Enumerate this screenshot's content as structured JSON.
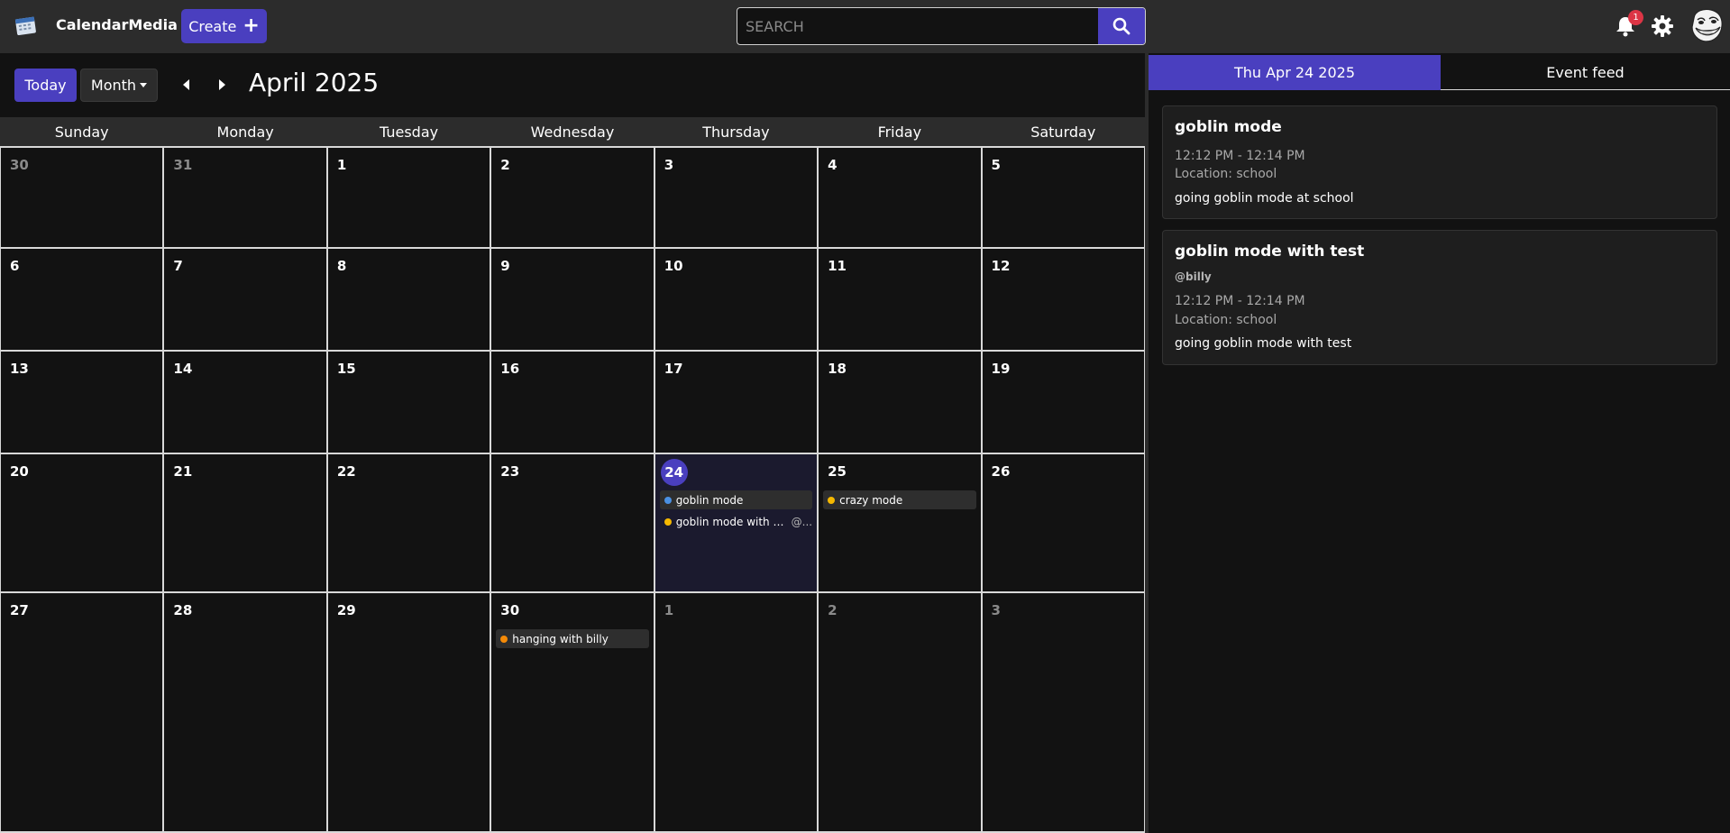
{
  "app": {
    "name": "CalendarMedia"
  },
  "header": {
    "create_label": "Create",
    "search_placeholder": "SEARCH",
    "notification_count": "1"
  },
  "toolbar": {
    "today_label": "Today",
    "view_label": "Month",
    "title": "April 2025"
  },
  "weekdays": [
    "Sunday",
    "Monday",
    "Tuesday",
    "Wednesday",
    "Thursday",
    "Friday",
    "Saturday"
  ],
  "weeks": [
    [
      {
        "d": "30",
        "m": true
      },
      {
        "d": "31",
        "m": true
      },
      {
        "d": "1"
      },
      {
        "d": "2"
      },
      {
        "d": "3"
      },
      {
        "d": "4"
      },
      {
        "d": "5"
      }
    ],
    [
      {
        "d": "6"
      },
      {
        "d": "7"
      },
      {
        "d": "8"
      },
      {
        "d": "9"
      },
      {
        "d": "10"
      },
      {
        "d": "11"
      },
      {
        "d": "12"
      }
    ],
    [
      {
        "d": "13"
      },
      {
        "d": "14"
      },
      {
        "d": "15"
      },
      {
        "d": "16"
      },
      {
        "d": "17"
      },
      {
        "d": "18"
      },
      {
        "d": "19"
      }
    ],
    [
      {
        "d": "20"
      },
      {
        "d": "21"
      },
      {
        "d": "22"
      },
      {
        "d": "23"
      },
      {
        "d": "24",
        "today": true,
        "events": [
          {
            "title": "goblin mode",
            "color": "#4a90e2",
            "highlighted": true
          },
          {
            "title": "goblin mode with test",
            "mention": "@...",
            "color": "#f5b800",
            "highlighted": false
          }
        ]
      },
      {
        "d": "25",
        "events": [
          {
            "title": "crazy mode",
            "color": "#f5b800",
            "highlighted": true
          }
        ]
      },
      {
        "d": "26"
      }
    ],
    [
      {
        "d": "27"
      },
      {
        "d": "28"
      },
      {
        "d": "29"
      },
      {
        "d": "30",
        "events": [
          {
            "title": "hanging with billy",
            "color": "#f58a07",
            "highlighted": true
          }
        ]
      },
      {
        "d": "1",
        "m": true
      },
      {
        "d": "2",
        "m": true
      },
      {
        "d": "3",
        "m": true
      }
    ]
  ],
  "panel": {
    "date_tab": "Thu Apr 24 2025",
    "feed_tab": "Event feed",
    "events": [
      {
        "title": "goblin mode",
        "user": "",
        "time": "12:12 PM - 12:14 PM",
        "location": "Location: school",
        "description": "going goblin mode at school"
      },
      {
        "title": "goblin mode with test",
        "user": "@billy",
        "time": "12:12 PM - 12:14 PM",
        "location": "Location: school",
        "description": "going goblin mode with test"
      }
    ]
  },
  "colors": {
    "accent": "#4a3fbf",
    "badge": "#dc3545",
    "navbar": "#2c2c2c"
  },
  "icons": [
    "calendar-logo-icon",
    "plus-icon",
    "search-icon",
    "bell-icon",
    "gear-icon",
    "troll-face-avatar",
    "chevron-left-icon",
    "chevron-right-icon",
    "caret-down-icon"
  ]
}
